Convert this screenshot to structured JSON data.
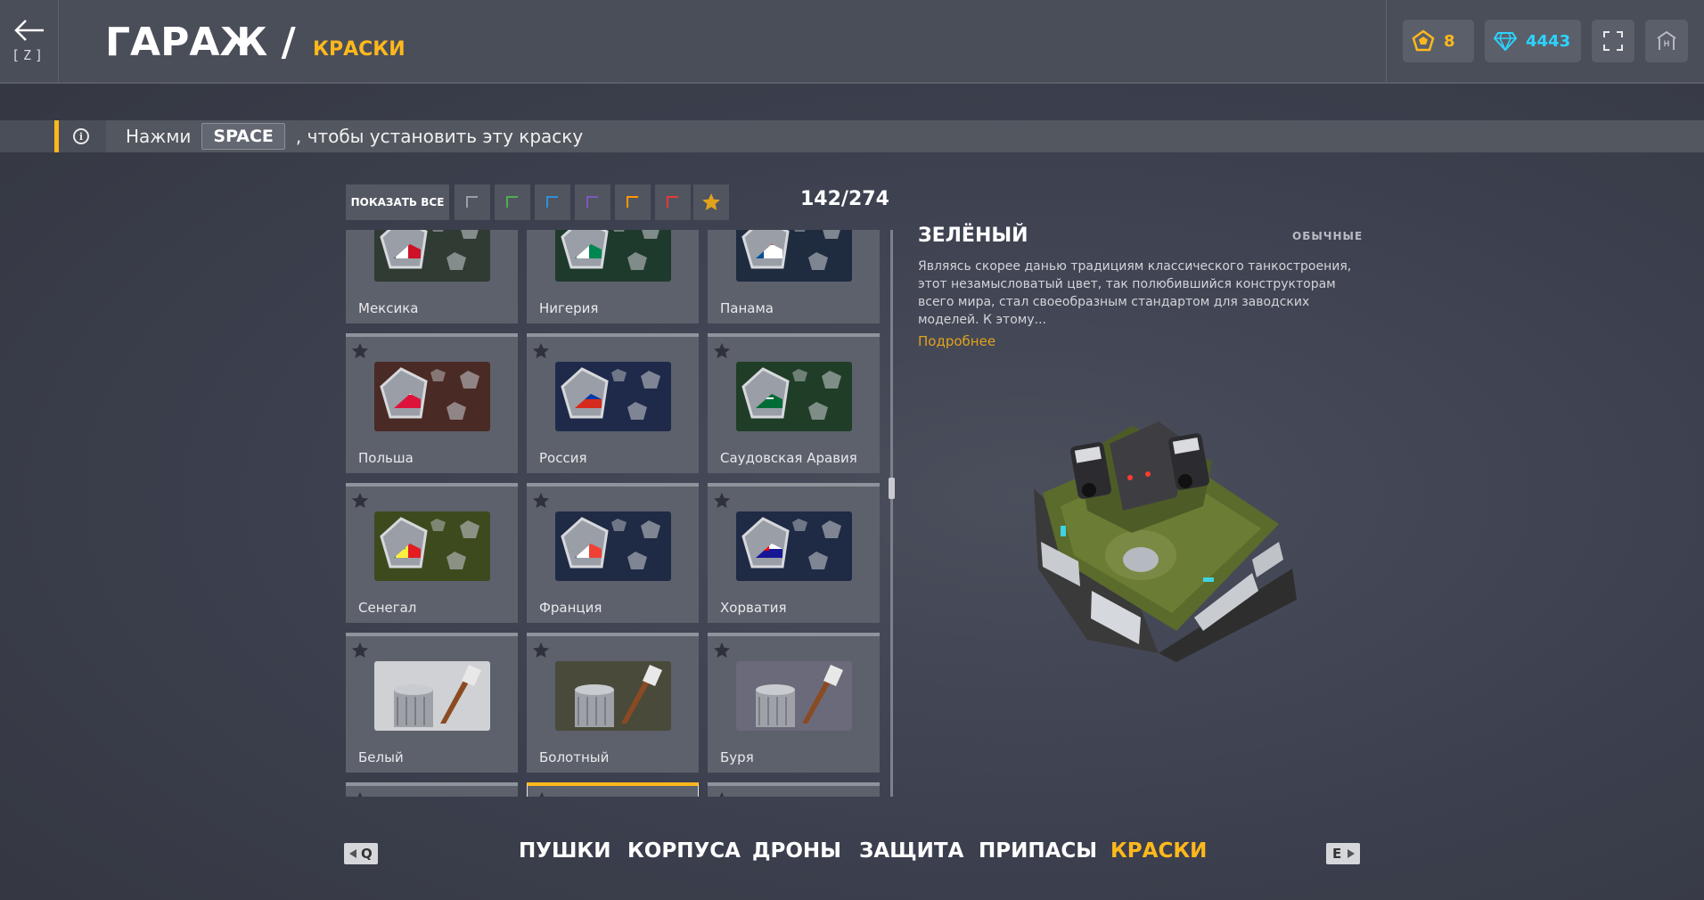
{
  "header": {
    "back_key": "[Z]",
    "title": "ГАРАЖ /",
    "subtitle": "КРАСКИ",
    "crystals": "8",
    "diamonds": "4443"
  },
  "hint": {
    "before": "Нажми",
    "key": "SPACE",
    "after": ", чтобы установить эту краску"
  },
  "filters": {
    "show_all": "ПОКАЗАТЬ ВСЕ",
    "rarity_colors": [
      "#9a9ea8",
      "#4caf50",
      "#2f8fd8",
      "#7e57c2",
      "#ff9800",
      "#e53935"
    ],
    "counter": "142/274"
  },
  "paints": [
    {
      "label": "Мексика",
      "flag": "mexico"
    },
    {
      "label": "Нигерия",
      "flag": "nigeria"
    },
    {
      "label": "Панама",
      "flag": "panama"
    },
    {
      "label": "Польша",
      "flag": "poland"
    },
    {
      "label": "Россия",
      "flag": "russia"
    },
    {
      "label": "Саудовская Аравия",
      "flag": "saudi"
    },
    {
      "label": "Сенегал",
      "flag": "senegal"
    },
    {
      "label": "Франция",
      "flag": "france"
    },
    {
      "label": "Хорватия",
      "flag": "croatia"
    },
    {
      "label": "Белый",
      "flag": "white-paint"
    },
    {
      "label": "Болотный",
      "flag": "swamp-paint"
    },
    {
      "label": "Буря",
      "flag": "storm-paint"
    },
    {
      "label": "",
      "flag": "red-paint"
    },
    {
      "label": "",
      "flag": "grey-paint"
    },
    {
      "label": "",
      "flag": "lime-paint"
    }
  ],
  "detail": {
    "name": "ЗЕЛЁНЫЙ",
    "rarity": "ОБЫЧНЫЕ",
    "description": "Являясь скорее данью традициям классического танкостроения, этот незамысловатый цвет, так полюбившийся конструкторам всего мира, стал своеобразным стандартом для заводских моделей. К этому...",
    "more": "Подробнее"
  },
  "nav": {
    "prev_key": "Q",
    "next_key": "E",
    "tabs": [
      {
        "label": "ПУШКИ",
        "active": false
      },
      {
        "label": "КОРПУСА",
        "active": false
      },
      {
        "label": "ДРОНЫ",
        "active": false
      },
      {
        "label": "ЗАЩИТА",
        "active": false
      },
      {
        "label": "ПРИПАСЫ",
        "active": false
      },
      {
        "label": "КРАСКИ",
        "active": true
      }
    ]
  },
  "colors": {
    "accent": "#ffb81c",
    "diamond": "#2bd4ff",
    "card_bg": "#5d616c"
  }
}
